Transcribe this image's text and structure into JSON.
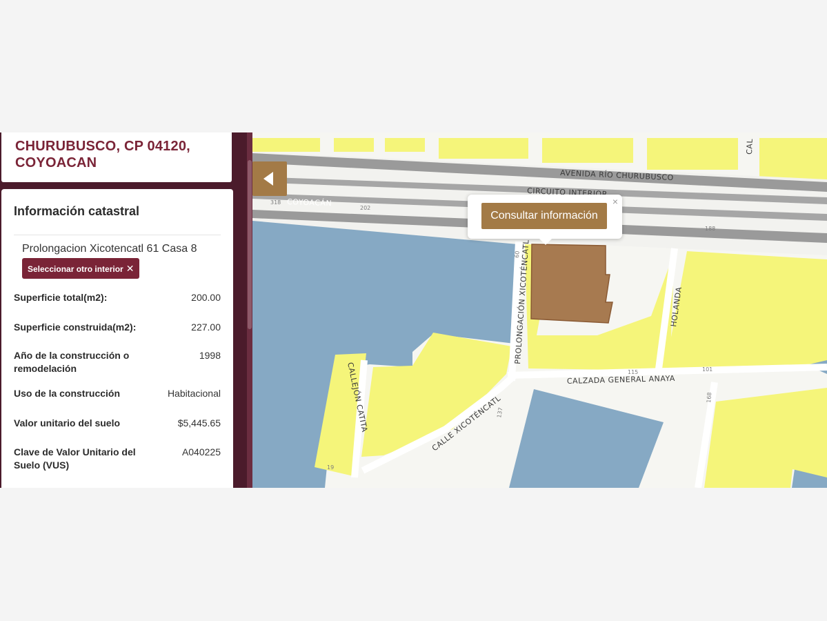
{
  "address_card": {
    "line1": "CHURUBUSCO, CP 04120,",
    "line2": "COYOACAN"
  },
  "info": {
    "title": "Información catastral",
    "address": "Prolongacion Xicotencatl 61 Casa 8",
    "select_button": "Seleccionar otro interior",
    "select_button_icon": "close-icon",
    "rows": [
      {
        "label": "Superficie total(m2):",
        "value": "200.00"
      },
      {
        "label": "Superficie construida(m2):",
        "value": "227.00"
      },
      {
        "label": "Año de la construcción o remodelación",
        "value": "1998"
      },
      {
        "label": "Uso de la construcción",
        "value": "Habitacional"
      },
      {
        "label": "Valor unitario del suelo",
        "value": "$5,445.65"
      },
      {
        "label": "Clave de Valor Unitario del Suelo (VUS)",
        "value": "A040225"
      }
    ]
  },
  "map": {
    "popup_button": "Consultar información",
    "popup_close": "×",
    "collapse_icon": "chevron-left-icon",
    "streets": {
      "avenida": "AVENIDA RÍO CHURUBUSCO",
      "circuito": "CIRCUITO INTERIOR",
      "coyoacan": "COYOACÁN",
      "prolongacion": "PROLONGACIÓN XICOTÉNCATL",
      "holanda": "HOLANDA",
      "calzada": "CALZADA GENERAL ANAYA",
      "callejon": "CALLEJÓN CATITA",
      "calle_xico": "CALLE XICOTÉNCATL",
      "cal": "CAL"
    },
    "numbers": [
      "318",
      "202",
      "188",
      "115",
      "101",
      "168",
      "137",
      "19",
      "60"
    ],
    "colors": {
      "yellow": "#f5f57a",
      "blue": "#86a9c4",
      "selected": "#a77a50",
      "road": "#9a9a9a",
      "accent": "#a37a46",
      "brand": "#7a2437"
    }
  }
}
